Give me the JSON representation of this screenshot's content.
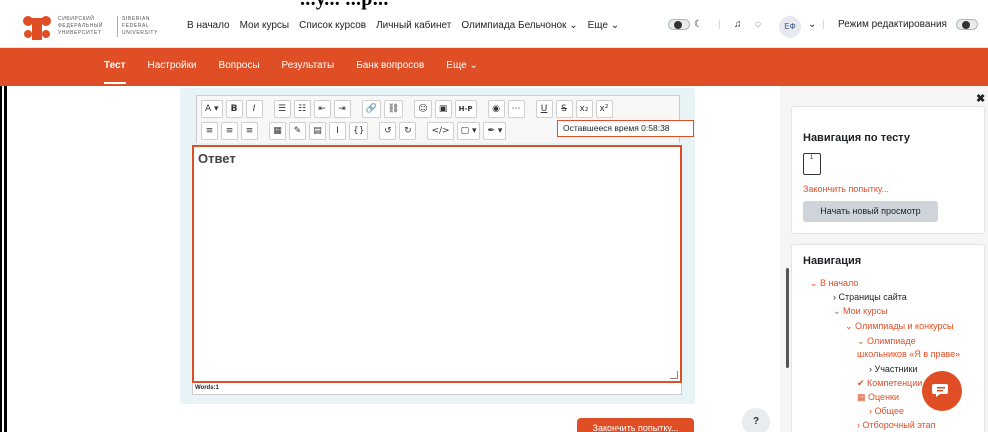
{
  "header": {
    "cropped_heading": "...у... ...р...",
    "logo_text_ru": [
      "СИБИРСКИЙ",
      "ФЕДЕРАЛЬНЫЙ",
      "УНИВЕРСИТЕТ"
    ],
    "logo_text_en": [
      "SIBERIAN",
      "FEDERAL",
      "UNIVERSITY"
    ],
    "nav_links": [
      "В начало",
      "Мои курсы",
      "Список курсов",
      "Личный кабинет",
      "Олимпиада Бельчонок ⌄",
      "Еще ⌄"
    ],
    "avatar_initials": "ЕФ",
    "edit_mode_label": "Режим редактирования"
  },
  "subnav": {
    "items": [
      "Тест",
      "Настройки",
      "Вопросы",
      "Результаты",
      "Банк вопросов",
      "Еще ⌄"
    ],
    "active": "Тест"
  },
  "editor": {
    "toolbar_row1": [
      "A ▾",
      "B",
      "I",
      "☰",
      "☷",
      "⇤",
      "⇥",
      "🔗",
      "⛓",
      "☺",
      "▣",
      "H-P",
      "◉",
      "⋯",
      "U",
      "S",
      "x₂",
      "x²"
    ],
    "toolbar_row2": [
      "≡",
      "≡",
      "≡",
      "▦",
      "✎",
      "▤",
      "Ⅰ",
      "{}",
      "↺",
      "↻",
      "</>",
      "▢ ▾",
      "✒ ▾"
    ],
    "content": "Ответ",
    "status": "Words:1"
  },
  "timer_tooltip": "Оставшееся время 0:58:38",
  "finish_attempt_button": "Закончить попытку...",
  "help_button": "?",
  "quiz_nav": {
    "title": "Навигация по тесту",
    "question_number": "1",
    "finish_link": "Закончить попытку...",
    "new_preview_button": "Начать новый просмотр"
  },
  "navigation": {
    "title": "Навигация",
    "items": [
      {
        "label": "⌄ В начало",
        "style": "orange"
      },
      {
        "label": "› Страницы сайта",
        "style": "dark"
      },
      {
        "label": "⌄ Мои курсы",
        "style": "orange"
      },
      {
        "label": "⌄ Олимпиады и конкурсы",
        "style": "orange"
      },
      {
        "label": "⌄ Олимпиаде",
        "style": "orange"
      },
      {
        "label": "школьников «Я в праве»",
        "style": "orange"
      },
      {
        "label": "› Участники",
        "style": "dark"
      },
      {
        "label": "✔ Компетенции",
        "style": "orange"
      },
      {
        "label": "▦ Оценки",
        "style": "orange"
      },
      {
        "label": "› Общее",
        "style": "orange"
      },
      {
        "label": "› Отборочный этап",
        "style": "orange"
      }
    ]
  },
  "colors": {
    "accent": "#e04e26",
    "panel": "#e7f3f5",
    "drawer": "#f5f5f5"
  }
}
